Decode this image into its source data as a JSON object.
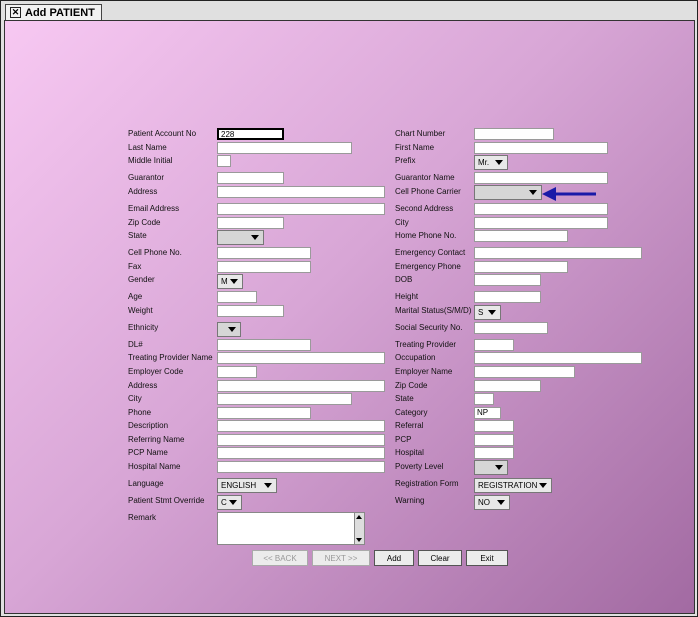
{
  "tab": {
    "title": "Add PATIENT"
  },
  "fields_left": [
    {
      "label": "Patient Account No"
    },
    {
      "label": "Last Name"
    },
    {
      "label": "Middle Initial"
    },
    {
      "label": "Guarantor"
    },
    {
      "label": "Address"
    },
    {
      "label": "Email Address"
    },
    {
      "label": "Zip Code"
    },
    {
      "label": "State"
    },
    {
      "label": "Cell Phone No."
    },
    {
      "label": "Fax"
    },
    {
      "label": "Gender"
    },
    {
      "label": "Age"
    },
    {
      "label": "Weight"
    },
    {
      "label": "Ethnicity"
    },
    {
      "label": "DL#"
    },
    {
      "label": "Treating Provider Name"
    },
    {
      "label": "Employer Code"
    },
    {
      "label": "Address"
    },
    {
      "label": "City"
    },
    {
      "label": "Phone"
    },
    {
      "label": "Description"
    },
    {
      "label": "Referring Name"
    },
    {
      "label": "PCP Name"
    },
    {
      "label": "Hospital Name"
    },
    {
      "label": "Language"
    },
    {
      "label": "Patient Stmt Override"
    },
    {
      "label": "Remark"
    }
  ],
  "fields_right": [
    {
      "label": "Chart Number"
    },
    {
      "label": "First Name"
    },
    {
      "label": "Prefix"
    },
    {
      "label": "Guarantor Name"
    },
    {
      "label": "Cell Phone Carrier"
    },
    {
      "label": "Second Address"
    },
    {
      "label": "City"
    },
    {
      "label": "Home Phone No."
    },
    {
      "label": "Emergency Contact"
    },
    {
      "label": "Emergency Phone"
    },
    {
      "label": "DOB"
    },
    {
      "label": "Height"
    },
    {
      "label": "Marital Status(S/M/D)"
    },
    {
      "label": "Social Security No."
    },
    {
      "label": "Treating Provider"
    },
    {
      "label": "Occupation"
    },
    {
      "label": "Employer Name"
    },
    {
      "label": "Zip Code"
    },
    {
      "label": "State"
    },
    {
      "label": "Category"
    },
    {
      "label": "Referral"
    },
    {
      "label": "PCP"
    },
    {
      "label": "Hospital"
    },
    {
      "label": "Poverty Level"
    },
    {
      "label": "Registration Form"
    },
    {
      "label": "Warning"
    }
  ],
  "values": {
    "patient_account_no": "228",
    "prefix": "Mr.",
    "gender": "M",
    "marital_status": "S",
    "category": "NP",
    "language": "ENGLISH",
    "patient_stmt_override": "C",
    "registration_form": "REGISTRATION",
    "warning": "NO"
  },
  "buttons": {
    "back": "<< BACK",
    "next": "NEXT >>",
    "add": "Add",
    "clear": "Clear",
    "exit": "Exit"
  },
  "colors": {
    "annotation_arrow": "#1a1aa8"
  }
}
